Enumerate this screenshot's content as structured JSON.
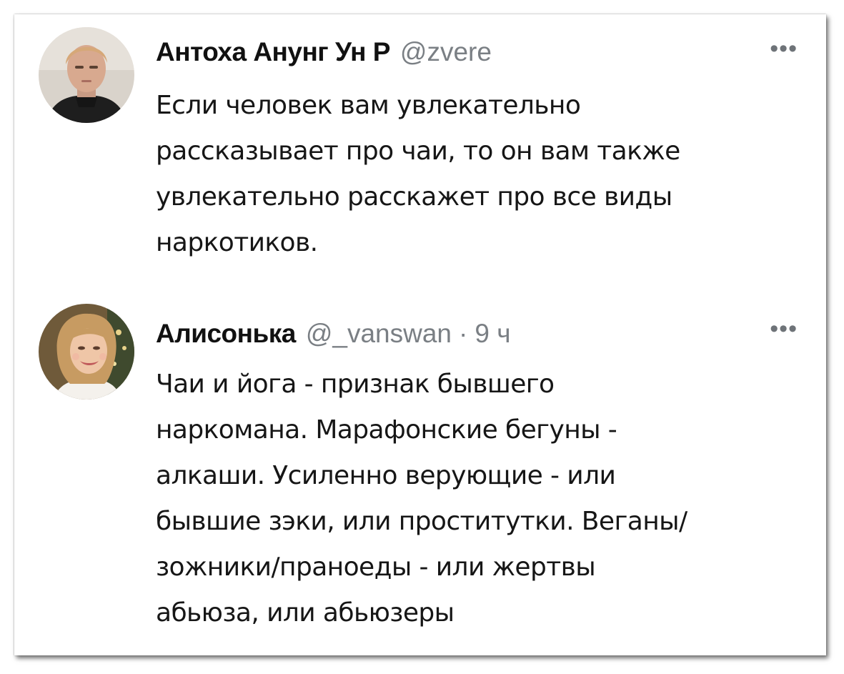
{
  "tweets": [
    {
      "author_name": "Антоха Анунг Ун Р",
      "handle": "@zvere",
      "more_icon": "more-horizontal-icon",
      "text_lines": [
        "Если человек вам увлекательно",
        "рассказывает про чаи, то он вам также",
        "увлекательно расскажет про все виды",
        "наркотиков."
      ]
    },
    {
      "author_name": "Алисонька",
      "handle": "@_vanswan",
      "separator": "·",
      "time": "9 ч",
      "more_icon": "more-horizontal-icon",
      "text_lines": [
        "Чаи и йога - признак бывшего",
        "наркомана. Марафонские бегуны -",
        "алкаши. Усиленно верующие - или",
        "бывшие зэки, или проститутки. Веганы/",
        "зожники/праноеды - или жертвы",
        "абьюза, или абьюзеры"
      ]
    }
  ],
  "colors": {
    "text": "#161616",
    "meta": "#7a7f84",
    "background": "#ffffff"
  }
}
